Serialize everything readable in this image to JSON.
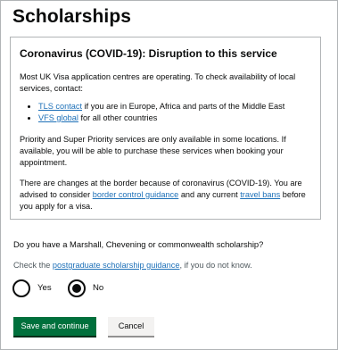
{
  "page": {
    "title": "Scholarships"
  },
  "notice": {
    "heading": "Coronavirus (COVID-19): Disruption to this service",
    "intro": "Most UK Visa application centres are operating. To check availability of local services, contact:",
    "contacts": [
      {
        "link_text": "TLS contact",
        "rest": " if you are in Europe, Africa and parts of the Middle East"
      },
      {
        "link_text": "VFS global",
        "rest": " for all other countries"
      }
    ],
    "priority": "Priority and Super Priority services are only available in some locations. If available, you will be able to purchase these services when booking your appointment.",
    "border": {
      "before": "There are changes at the border because of coronavirus (COVID-19). You are advised to consider ",
      "link1": "border control guidance",
      "middle": " and any current ",
      "link2": "travel bans",
      "after": " before you apply for a visa."
    }
  },
  "question": {
    "text": "Do you have a Marshall, Chevening or commonwealth scholarship?",
    "hint_before": "Check the ",
    "hint_link": "postgraduate scholarship guidance",
    "hint_after": ", if you do not know."
  },
  "options": {
    "yes_label": "Yes",
    "no_label": "No",
    "selected": "No"
  },
  "actions": {
    "save_label": "Save and continue",
    "cancel_label": "Cancel"
  },
  "colors": {
    "link": "#1d70b8",
    "primary_button": "#00703c",
    "secondary_button": "#f3f2f1",
    "text": "#0b0c0c",
    "border": "#b1b4b6"
  }
}
